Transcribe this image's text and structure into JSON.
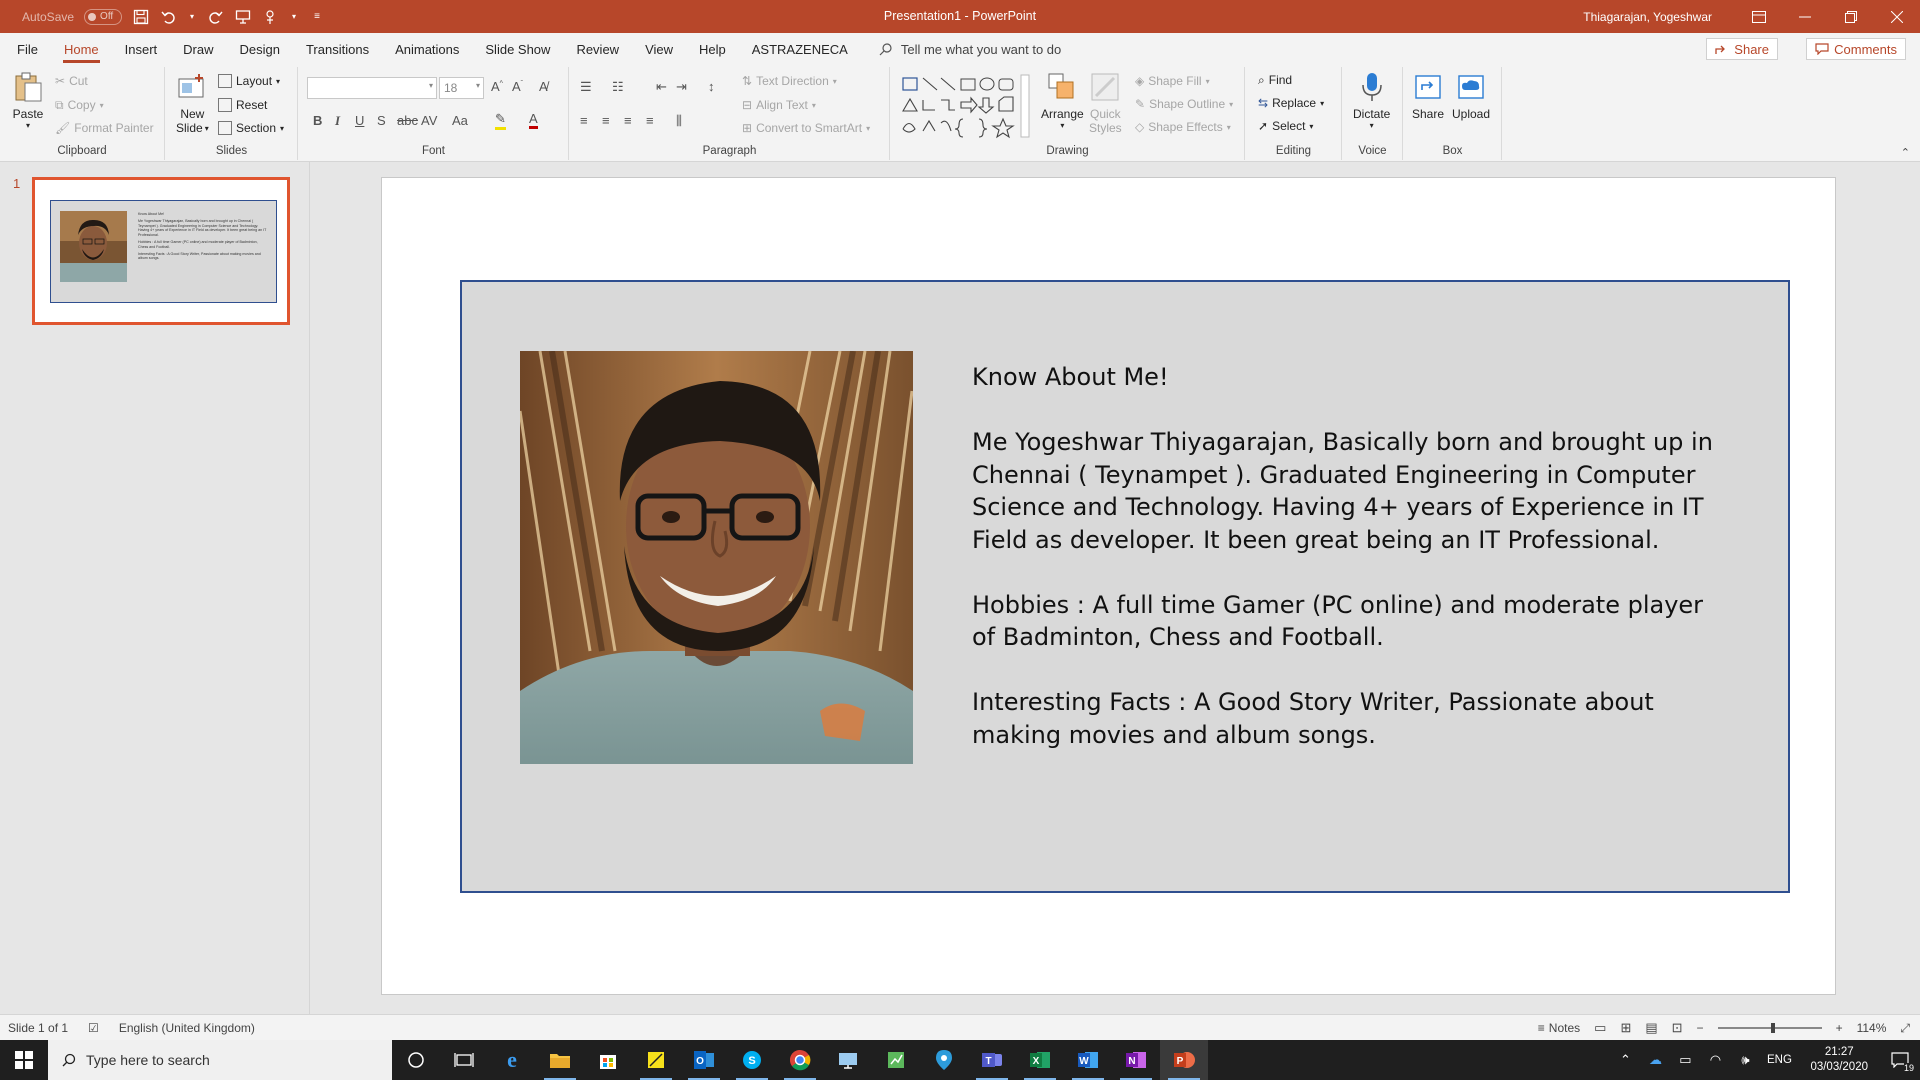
{
  "titlebar": {
    "autosave_label": "AutoSave",
    "autosave_state": "Off",
    "document_title": "Presentation1  -  PowerPoint",
    "user_name": "Thiagarajan, Yogeshwar",
    "accent_color": "#b7472a"
  },
  "tabs": [
    "File",
    "Home",
    "Insert",
    "Draw",
    "Design",
    "Transitions",
    "Animations",
    "Slide Show",
    "Review",
    "View",
    "Help",
    "ASTRAZENECA"
  ],
  "active_tab": "Home",
  "tell_me_placeholder": "Tell me what you want to do",
  "share_label": "Share",
  "comments_label": "Comments",
  "ribbon": {
    "clipboard": {
      "label": "Clipboard",
      "paste": "Paste",
      "cut": "Cut",
      "copy": "Copy",
      "format_painter": "Format Painter"
    },
    "slides": {
      "label": "Slides",
      "new_slide_line1": "New",
      "new_slide_line2": "Slide",
      "layout": "Layout",
      "reset": "Reset",
      "section": "Section"
    },
    "font": {
      "label": "Font",
      "font_name": "",
      "font_size": "18"
    },
    "paragraph": {
      "label": "Paragraph",
      "text_direction": "Text Direction",
      "align_text": "Align Text",
      "convert_smartart": "Convert to SmartArt"
    },
    "drawing": {
      "label": "Drawing",
      "arrange": "Arrange",
      "quick_styles_line1": "Quick",
      "quick_styles_line2": "Styles",
      "shape_fill": "Shape Fill",
      "shape_outline": "Shape Outline",
      "shape_effects": "Shape Effects"
    },
    "editing": {
      "label": "Editing",
      "find": "Find",
      "replace": "Replace",
      "select": "Select"
    },
    "voice": {
      "label": "Voice",
      "dictate": "Dictate"
    },
    "box": {
      "label": "Box",
      "share": "Share",
      "upload": "Upload"
    }
  },
  "thumbnail": {
    "slide_number": "1"
  },
  "slide": {
    "heading": "Know About Me!",
    "para1": "Me Yogeshwar Thiyagarajan, Basically born and brought up in Chennai ( Teynampet ). Graduated Engineering in Computer Science and Technology. Having 4+ years of Experience in IT Field as developer. It been great being an IT Professional.",
    "para2": "Hobbies :  A full time Gamer (PC online) and moderate player of Badminton, Chess and Football.",
    "para3": "Interesting Facts : A Good Story Writer, Passionate about making movies and album songs."
  },
  "statusbar": {
    "slide_info": "Slide 1 of 1",
    "language": "English (United Kingdom)",
    "notes": "Notes",
    "zoom": "114%"
  },
  "taskbar": {
    "search_placeholder": "Type here to search",
    "language": "ENG",
    "time": "21:27",
    "date": "03/03/2020",
    "notification_count": "19"
  }
}
